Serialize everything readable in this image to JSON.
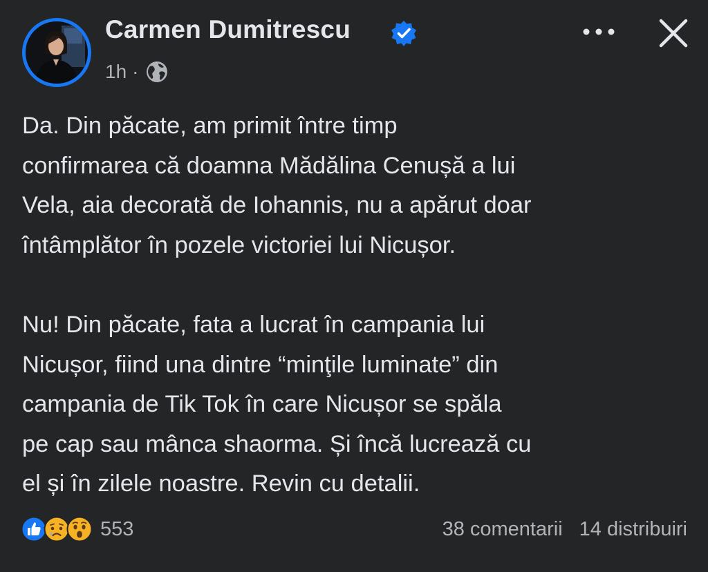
{
  "post": {
    "author": "Carmen Dumitrescu",
    "verified_icon": "verified-badge-icon",
    "time": "1h",
    "separator": "·",
    "audience_icon": "globe-icon",
    "more_icon": "more-options-icon",
    "close_icon": "close-icon",
    "body": [
      "Da. Din păcate, am primit între timp",
      "confirmarea că doamna Mădălina Cenușă a lui",
      "Vela, aia decorată de Iohannis, nu a apărut doar",
      "întâmplător în pozele victoriei lui Nicușor.",
      "Nu! Din păcate, fata a lucrat în campania lui",
      "Nicușor, fiind una dintre “minţile luminate” din",
      "campania de Tik Tok în care Nicușor se spăla",
      "pe cap sau mânca shaorma. Și încă lucrează cu",
      "el și în zilele noastre. Revin cu detalii."
    ]
  },
  "footer": {
    "reactions": [
      "like-icon",
      "sad-icon",
      "wow-icon"
    ],
    "reaction_count": "553",
    "comments": "38 comentarii",
    "shares": "14 distribuiri"
  },
  "colors": {
    "background": "#242526",
    "text": "#e4e6eb",
    "secondary": "#b0b3b8",
    "accent": "#1877f2"
  }
}
